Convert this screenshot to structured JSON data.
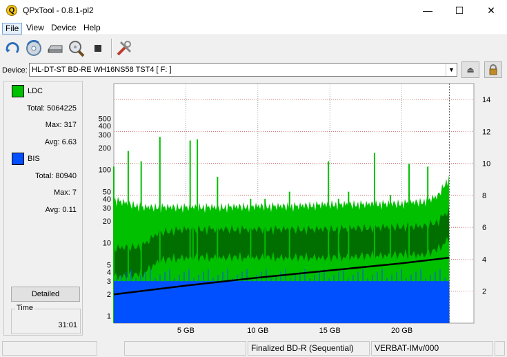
{
  "window": {
    "title": "QPxTool - 0.8.1-pl2",
    "app_icon_letter": "Q"
  },
  "menu": {
    "items": [
      "File",
      "View",
      "Device",
      "Help"
    ]
  },
  "toolbar": {
    "buttons": [
      "refresh-icon",
      "disc-scan-icon",
      "drive-icon",
      "magnify-disc-icon",
      "stop-icon",
      "tools-icon"
    ]
  },
  "device": {
    "label": "Device:",
    "value": "HL-DT-ST BD-RE  WH16NS58  TST4 [ F: ]"
  },
  "ldc": {
    "name": "LDC",
    "color": "#00c000",
    "total_label": "Total:",
    "total": "5064225",
    "max_label": "Max:",
    "max": "317",
    "avg_label": "Avg:",
    "avg": "6.63"
  },
  "bis": {
    "name": "BIS",
    "color": "#0050ff",
    "total_label": "Total:",
    "total": "80940",
    "max_label": "Max:",
    "max": "7",
    "avg_label": "Avg:",
    "avg": "0.11"
  },
  "detailed_label": "Detailed",
  "time": {
    "label": "Time",
    "value": "31:01"
  },
  "status": {
    "cells": [
      "",
      "",
      "Finalized BD-R (Sequential)",
      "VERBAT-IMv/000",
      ""
    ]
  },
  "chart_data": {
    "type": "area",
    "x_unit": "GB",
    "x_ticks": [
      "5 GB",
      "10 GB",
      "15 GB",
      "20 GB"
    ],
    "x_tick_values": [
      5,
      10,
      15,
      20
    ],
    "x_max": 23.3,
    "xlim": [
      0,
      25
    ],
    "y_left_ticks": [
      "1",
      "2",
      "3",
      "4",
      "5",
      "10",
      "20",
      "30",
      "40",
      "50",
      "100",
      "200",
      "300",
      "400",
      "500"
    ],
    "y_left_tick_values": [
      1,
      2,
      3,
      4,
      5,
      10,
      20,
      30,
      40,
      50,
      100,
      200,
      300,
      400,
      500
    ],
    "y_left_scale": "log",
    "ylim_left": [
      0.8,
      1500
    ],
    "y_right_ticks": [
      "2",
      "4",
      "6",
      "8",
      "10",
      "12",
      "14"
    ],
    "y_right_tick_values": [
      2,
      4,
      6,
      8,
      10,
      12,
      14
    ],
    "ylim_right": [
      0,
      15
    ],
    "series": [
      {
        "name": "LDC",
        "color": "#00c000",
        "x": [
          0,
          2,
          3.2,
          5,
          7.5,
          10,
          12.5,
          15,
          17.5,
          20,
          21.5,
          22.5,
          23.3
        ],
        "max": [
          40,
          32,
          32,
          32,
          32,
          33,
          33,
          35,
          35,
          36,
          38,
          45,
          80
        ],
        "typical": [
          20,
          18,
          17,
          17,
          18,
          18,
          18,
          19,
          19,
          20,
          22,
          28,
          40
        ]
      },
      {
        "name": "LDC average",
        "color": "#006000",
        "x": [
          0,
          2,
          3.2,
          5,
          7.5,
          10,
          12.5,
          15,
          17.5,
          20,
          21.5,
          22.5,
          23.3
        ],
        "values": [
          6,
          6.5,
          10,
          11,
          11,
          11,
          11,
          11,
          11.5,
          12,
          12,
          14,
          20
        ]
      },
      {
        "name": "BIS",
        "color": "#0050ff",
        "x": [
          0,
          23.3
        ],
        "values": [
          3,
          3
        ]
      },
      {
        "name": "Speed",
        "color": "#000000",
        "axis": "right",
        "x": [
          0,
          5,
          10,
          15,
          20,
          23.3
        ],
        "values": [
          1.8,
          2.35,
          2.85,
          3.3,
          3.75,
          4.1
        ]
      }
    ],
    "spikes": [
      {
        "x": 0,
        "value": 110
      },
      {
        "x": 1,
        "value": 180
      },
      {
        "x": 1.9,
        "value": 130
      },
      {
        "x": 3.2,
        "value": 280
      },
      {
        "x": 5.3,
        "value": 250
      },
      {
        "x": 5.5,
        "value": 30
      },
      {
        "x": 5.8,
        "value": 260
      },
      {
        "x": 7.2,
        "value": 80
      },
      {
        "x": 9.5,
        "value": 40
      },
      {
        "x": 10.5,
        "value": 40
      },
      {
        "x": 12.2,
        "value": 50
      },
      {
        "x": 14.9,
        "value": 130
      },
      {
        "x": 15.6,
        "value": 40
      },
      {
        "x": 16.3,
        "value": 50
      },
      {
        "x": 18.1,
        "value": 170
      },
      {
        "x": 19.2,
        "value": 45
      },
      {
        "x": 20.5,
        "value": 120
      },
      {
        "x": 21.8,
        "value": 110
      }
    ],
    "grid": true
  }
}
